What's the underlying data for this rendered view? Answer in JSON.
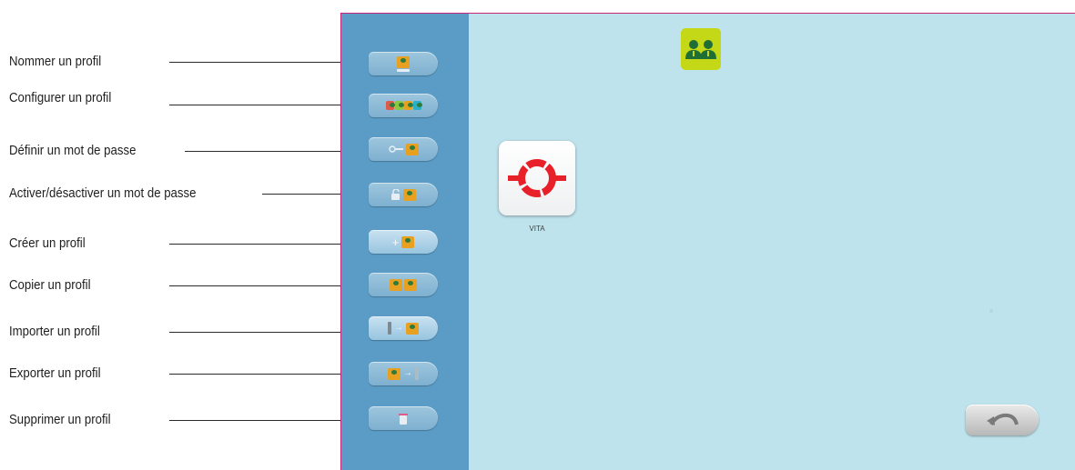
{
  "callouts": [
    {
      "label": "Nommer un profil"
    },
    {
      "label": "Configurer un profil"
    },
    {
      "label": "Définir un mot de passe"
    },
    {
      "label": "Activer/désactiver un mot de passe"
    },
    {
      "label": "Créer un profil"
    },
    {
      "label": "Copier un profil"
    },
    {
      "label": "Importer un profil"
    },
    {
      "label": "Exporter un profil"
    },
    {
      "label": "Supprimer un profil"
    }
  ],
  "sidebar_buttons": [
    {
      "icon": "name-profile-icon"
    },
    {
      "icon": "configure-profile-icon"
    },
    {
      "icon": "set-password-icon"
    },
    {
      "icon": "toggle-password-icon"
    },
    {
      "icon": "create-profile-icon"
    },
    {
      "icon": "copy-profile-icon"
    },
    {
      "icon": "import-profile-icon"
    },
    {
      "icon": "export-profile-icon"
    },
    {
      "icon": "delete-profile-icon"
    }
  ],
  "main": {
    "header_icon": "profiles-icon",
    "profile": {
      "label": "VITA",
      "icon": "vita-logo-icon"
    },
    "back_icon": "back-arrow-icon"
  },
  "colors": {
    "sidebar": "#5b9cc6",
    "content": "#bfe3ec",
    "border": "#c7277a",
    "profiles_tile": "#c4d818",
    "vita_ring": "#e8202a"
  }
}
